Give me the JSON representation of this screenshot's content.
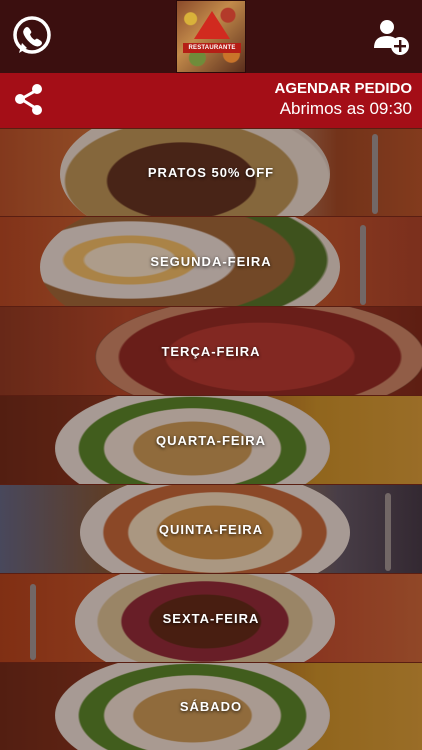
{
  "header": {
    "logo_text": "RESTAURANTE"
  },
  "info": {
    "title": "AGENDAR PEDIDO",
    "subtitle": "Abrimos as 09:30"
  },
  "menu": [
    {
      "label": "PRATOS 50% OFF"
    },
    {
      "label": "SEGUNDA-FEIRA"
    },
    {
      "label": "TERÇA-FEIRA"
    },
    {
      "label": "QUARTA-FEIRA"
    },
    {
      "label": "QUINTA-FEIRA"
    },
    {
      "label": "SEXTA-FEIRA"
    },
    {
      "label": "SÁBADO"
    }
  ],
  "colors": {
    "topbar": "#3b0f0f",
    "accent": "#a40e17"
  }
}
